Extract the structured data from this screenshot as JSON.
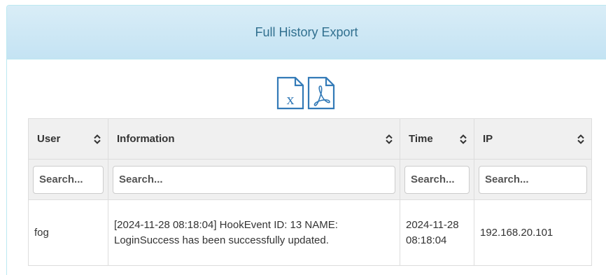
{
  "panel": {
    "title": "Full History Export"
  },
  "export": {
    "excel_icon": "excel-file-icon",
    "pdf_icon": "pdf-file-icon",
    "excel_letter": "x"
  },
  "table": {
    "columns": [
      {
        "label": "User"
      },
      {
        "label": "Information"
      },
      {
        "label": "Time"
      },
      {
        "label": "IP"
      }
    ],
    "filters": [
      {
        "placeholder": "Search..."
      },
      {
        "placeholder": "Search..."
      },
      {
        "placeholder": "Search..."
      },
      {
        "placeholder": "Search..."
      }
    ],
    "rows": [
      {
        "user": "fog",
        "information": "[2024-11-28 08:18:04] HookEvent ID: 13 NAME: LoginSuccess has been successfully updated.",
        "time": "2024-11-28 08:18:04",
        "ip": "192.168.20.101"
      }
    ]
  },
  "colors": {
    "heading_text": "#31708f",
    "heading_bg": "#d9edf7",
    "icon": "#337ab7"
  }
}
